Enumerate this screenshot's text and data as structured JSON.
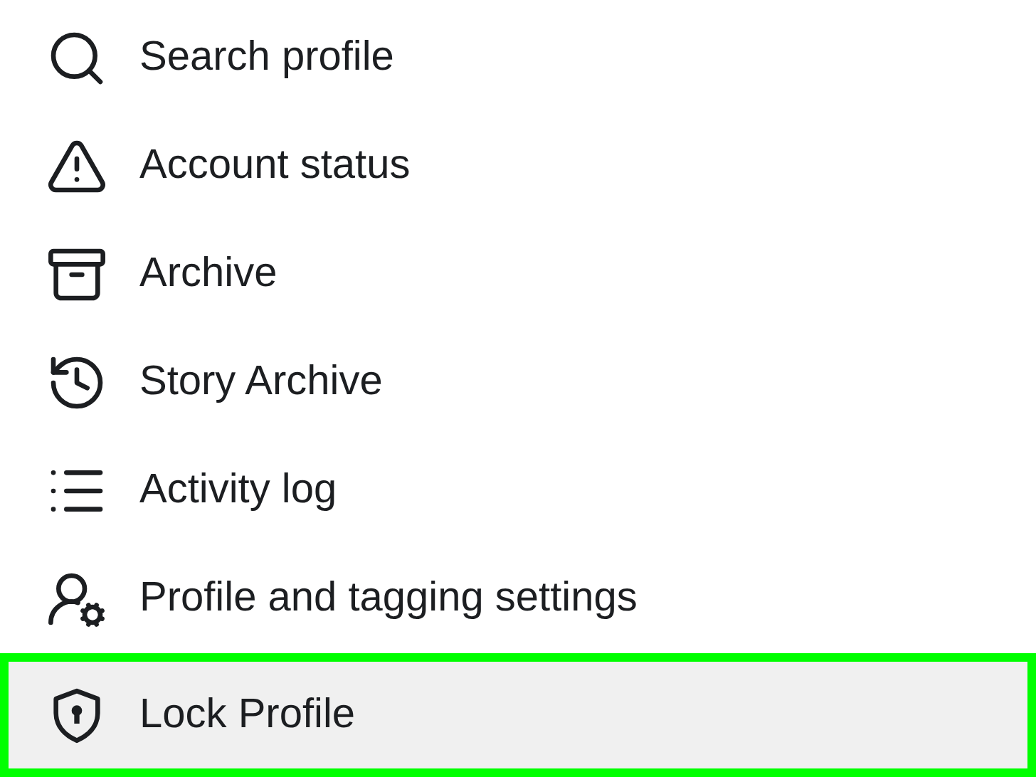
{
  "menu": {
    "items": [
      {
        "label": "Search profile",
        "highlighted": false
      },
      {
        "label": "Account status",
        "highlighted": false
      },
      {
        "label": "Archive",
        "highlighted": false
      },
      {
        "label": "Story Archive",
        "highlighted": false
      },
      {
        "label": "Activity log",
        "highlighted": false
      },
      {
        "label": "Profile and tagging settings",
        "highlighted": false
      },
      {
        "label": "Lock Profile",
        "highlighted": true
      }
    ]
  }
}
